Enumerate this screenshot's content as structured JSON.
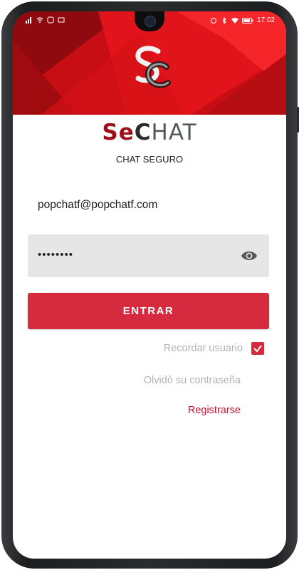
{
  "status_bar": {
    "time": "17:02",
    "battery": "battery-icon",
    "signal_icons": [
      "signal-icon",
      "wifi-icon",
      "notification-icon"
    ]
  },
  "brand": {
    "logo_part1": "Se",
    "logo_part2": "C",
    "logo_part3": "HAT",
    "subtitle": "CHAT SEGURO"
  },
  "form": {
    "email_value": "popchatf@popchatf.com",
    "password_value": "••••••••",
    "login_label": "ENTRAR",
    "remember_label": "Recordar usuario",
    "remember_checked": true,
    "forgot_label": "Olvidó su contraseña",
    "register_label": "Registrarse"
  },
  "colors": {
    "primary": "#d62b3e",
    "header": "#c90c12",
    "link": "#c8102e"
  }
}
